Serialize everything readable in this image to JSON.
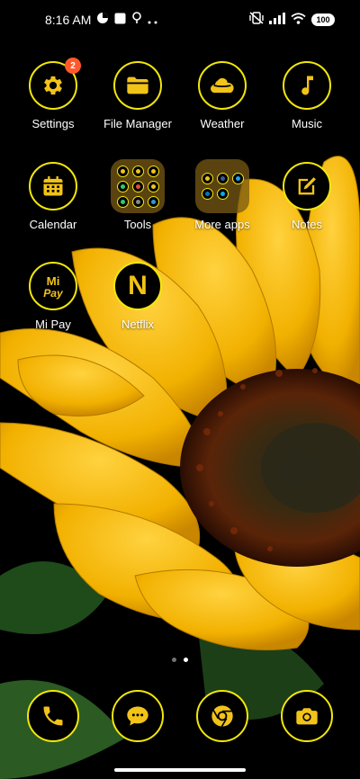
{
  "status": {
    "time": "8:16 AM",
    "battery": "100"
  },
  "apps": {
    "settings": {
      "label": "Settings",
      "badge": "2"
    },
    "file_manager": {
      "label": "File Manager"
    },
    "weather": {
      "label": "Weather"
    },
    "music": {
      "label": "Music"
    },
    "calendar": {
      "label": "Calendar"
    },
    "tools": {
      "label": "Tools"
    },
    "more_apps": {
      "label": "More apps"
    },
    "notes": {
      "label": "Notes"
    },
    "mi_pay": {
      "label": "Mi Pay",
      "logo_text_top": "Mi",
      "logo_text_bottom": "Pay"
    },
    "netflix": {
      "label": "Netflix",
      "logo_text": "N"
    }
  },
  "dock": [
    "phone-icon",
    "messages-icon",
    "chrome-icon",
    "camera-icon"
  ],
  "page_indicator": {
    "pages": 2,
    "current": 2
  },
  "colors": {
    "icon_accent": "#f2c318",
    "icon_ring": "#f2e70b",
    "badge": "#ff5a2c"
  }
}
